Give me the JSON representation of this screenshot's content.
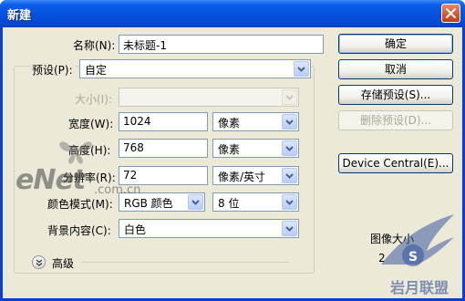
{
  "window": {
    "title": "新建"
  },
  "form": {
    "name": {
      "label": "名称(N):",
      "value": "未标题-1"
    },
    "preset": {
      "label": "预设(P):",
      "value": "自定"
    },
    "size": {
      "label": "大小(I):",
      "value": ""
    },
    "width": {
      "label": "宽度(W):",
      "value": "1024",
      "unit": "像素"
    },
    "height": {
      "label": "高度(H):",
      "value": "768",
      "unit": "像素"
    },
    "resolution": {
      "label": "分辨率(R):",
      "value": "72",
      "unit": "像素/英寸"
    },
    "color_mode": {
      "label": "颜色模式(M):",
      "value": "RGB 颜色",
      "depth": "8 位"
    },
    "background": {
      "label": "背景内容(C):",
      "value": "白色"
    },
    "advanced": {
      "label": "高级"
    }
  },
  "buttons": {
    "ok": "确定",
    "cancel": "取消",
    "save_preset": "存储预设(S)...",
    "delete_preset": "删除预设(D)...",
    "device_central": "Device Central(E)..."
  },
  "image_size": {
    "label": "图像大小",
    "value": "2"
  },
  "watermark": {
    "enet": "eNet",
    "domain": ".com.cn",
    "site": "岩月联盟"
  },
  "colors": {
    "titlebar": "#0653e0",
    "dialog_bg": "#ece9d8",
    "field_border": "#7f9db9",
    "button_border": "#003c74"
  }
}
